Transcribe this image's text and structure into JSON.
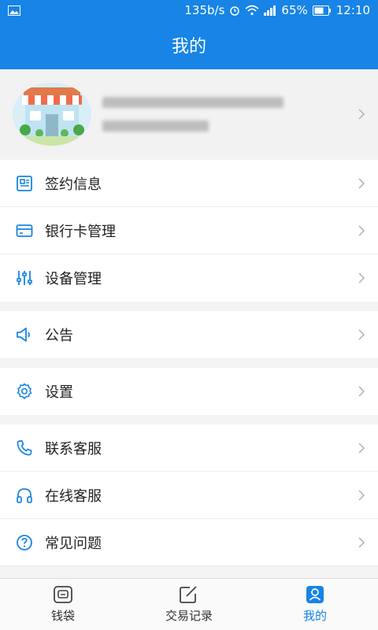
{
  "status_bar": {
    "speed": "135b/s",
    "battery": "65%",
    "time": "12:10"
  },
  "header": {
    "title": "我的"
  },
  "menu": [
    {
      "label": "签约信息",
      "icon": "contract-icon"
    },
    {
      "label": "银行卡管理",
      "icon": "bank-card-icon"
    },
    {
      "label": "设备管理",
      "icon": "device-settings-icon"
    },
    {
      "label": "公告",
      "icon": "megaphone-icon"
    },
    {
      "label": "设置",
      "icon": "gear-icon"
    },
    {
      "label": "联系客服",
      "icon": "phone-icon"
    },
    {
      "label": "在线客服",
      "icon": "headset-icon"
    },
    {
      "label": "常见问题",
      "icon": "question-icon"
    }
  ],
  "tabs": [
    {
      "label": "钱袋",
      "icon": "wallet-icon"
    },
    {
      "label": "交易记录",
      "icon": "edit-icon"
    },
    {
      "label": "我的",
      "icon": "user-icon",
      "active": true
    }
  ],
  "colors": {
    "accent": "#1784e6"
  }
}
